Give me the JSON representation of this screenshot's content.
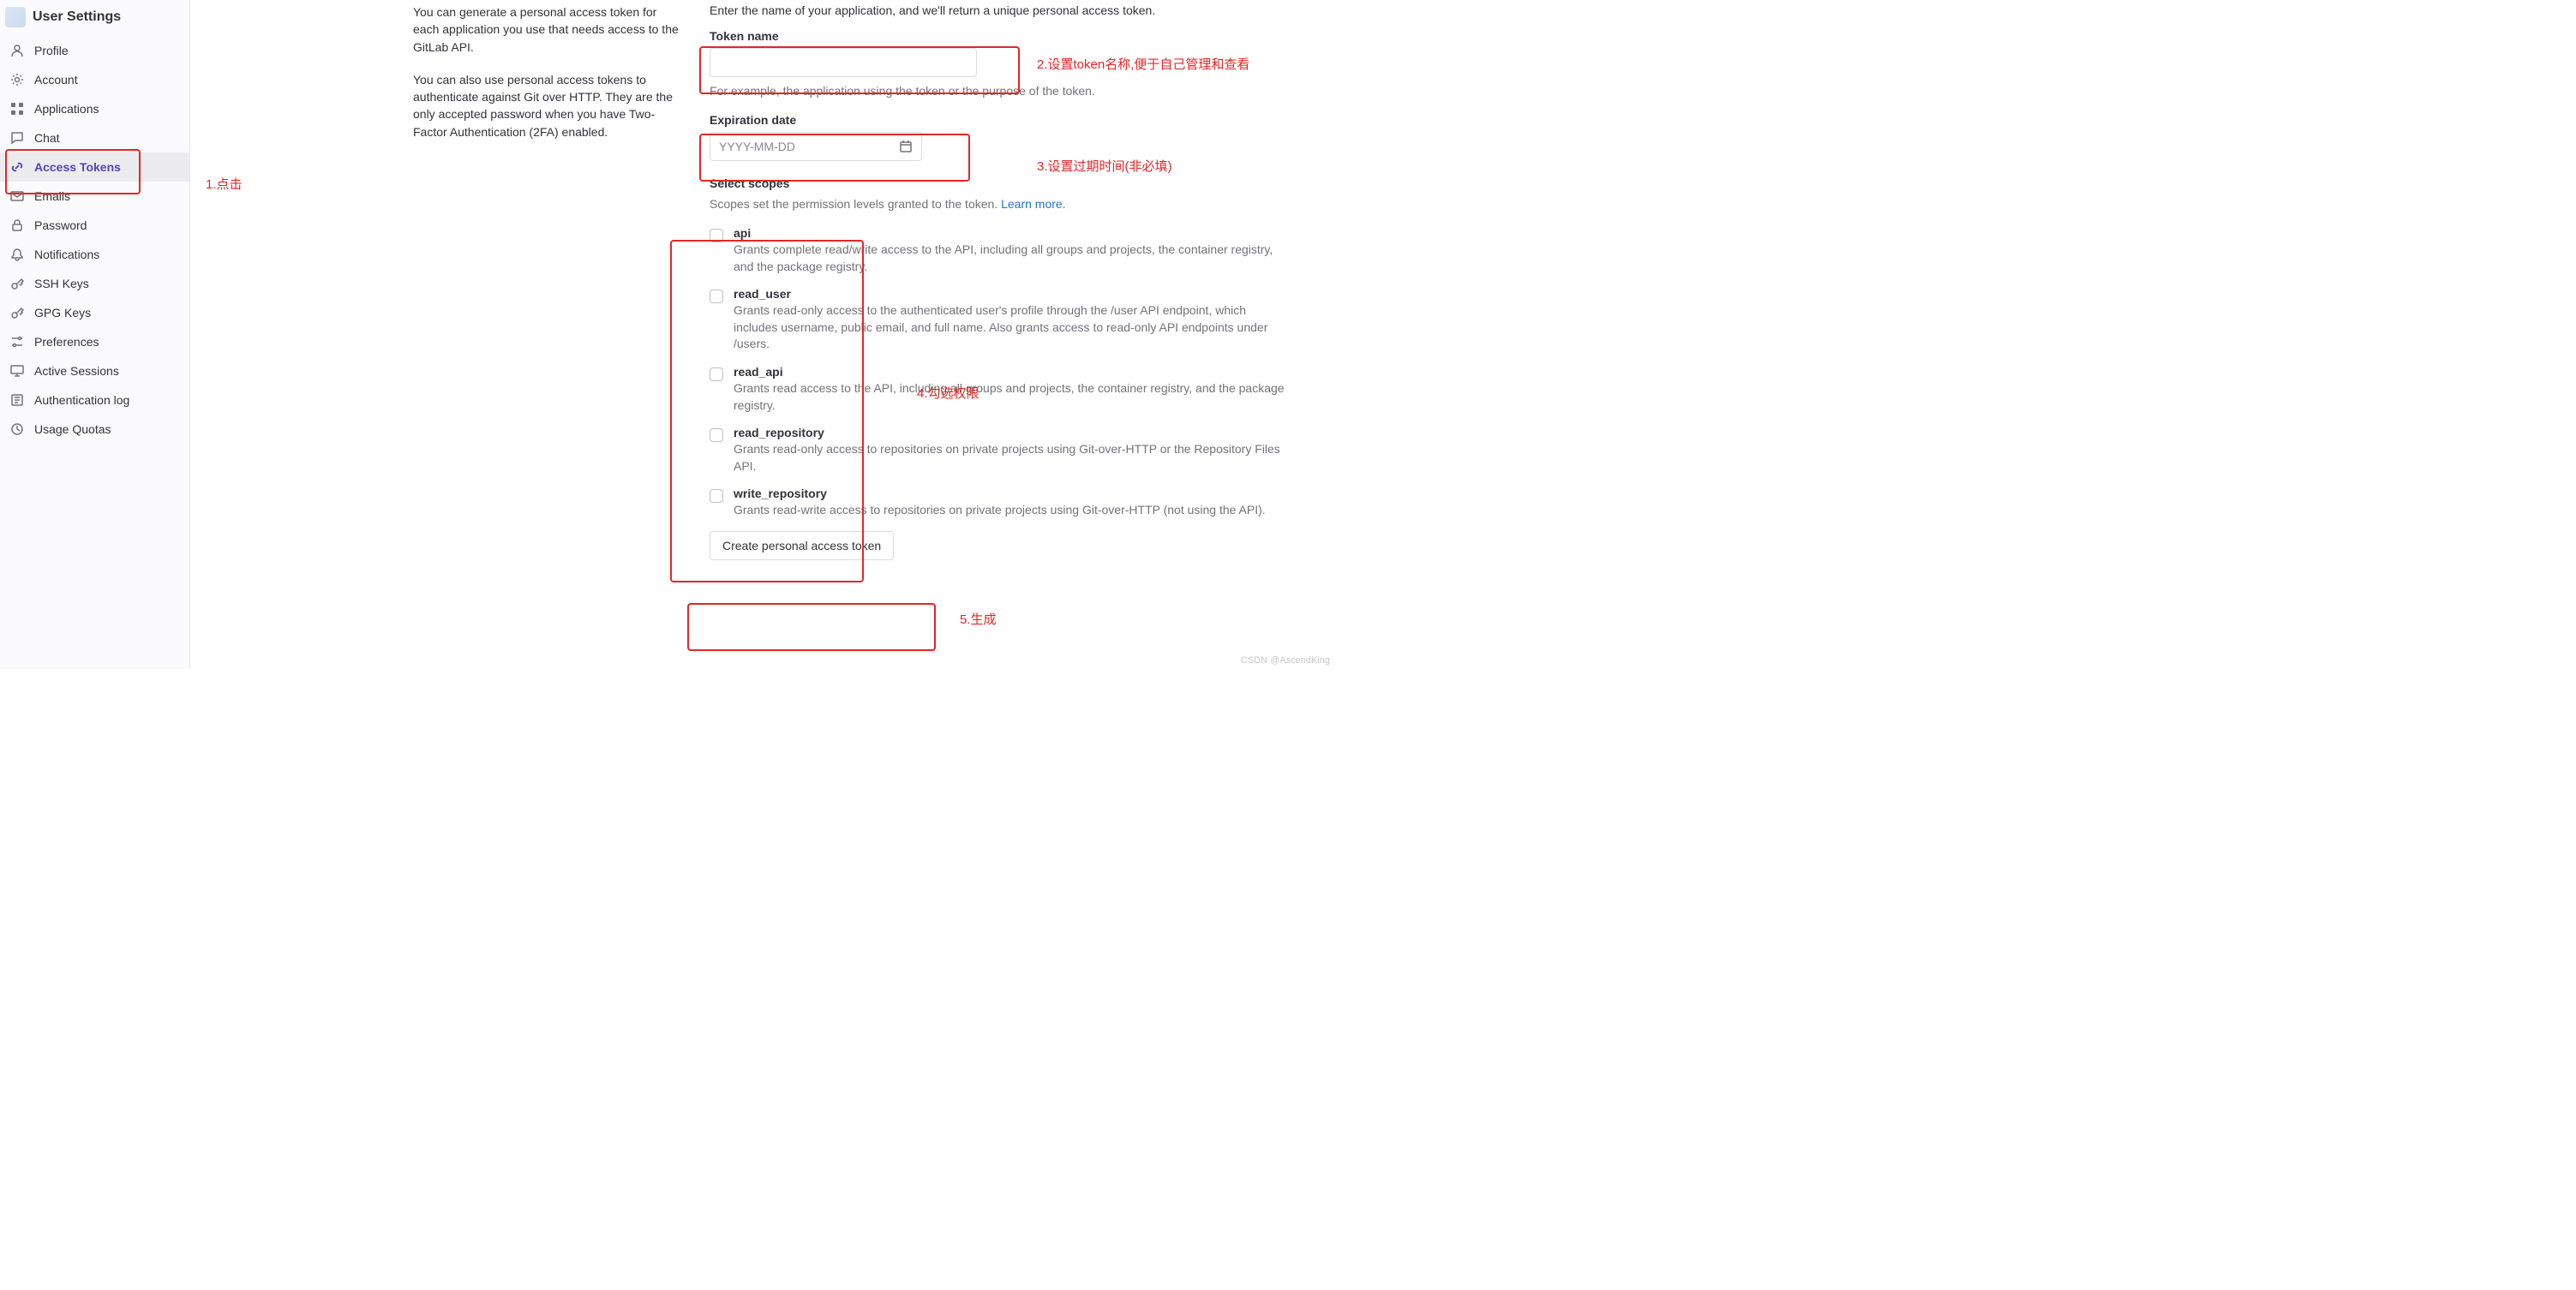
{
  "sidebar": {
    "title": "User Settings",
    "items": [
      {
        "label": "Profile",
        "icon": "profile"
      },
      {
        "label": "Account",
        "icon": "account"
      },
      {
        "label": "Applications",
        "icon": "applications"
      },
      {
        "label": "Chat",
        "icon": "chat"
      },
      {
        "label": "Access Tokens",
        "icon": "token",
        "active": true
      },
      {
        "label": "Emails",
        "icon": "email"
      },
      {
        "label": "Password",
        "icon": "lock"
      },
      {
        "label": "Notifications",
        "icon": "bell"
      },
      {
        "label": "SSH Keys",
        "icon": "key"
      },
      {
        "label": "GPG Keys",
        "icon": "key"
      },
      {
        "label": "Preferences",
        "icon": "preferences"
      },
      {
        "label": "Active Sessions",
        "icon": "monitor"
      },
      {
        "label": "Authentication log",
        "icon": "log"
      },
      {
        "label": "Usage Quotas",
        "icon": "quota"
      }
    ]
  },
  "desc": {
    "p1": "You can generate a personal access token for each application you use that needs access to the GitLab API.",
    "p2": "You can also use personal access tokens to authenticate against Git over HTTP. They are the only accepted password when you have Two-Factor Authentication (2FA) enabled."
  },
  "form": {
    "intro": "Enter the name of your application, and we'll return a unique personal access token.",
    "token_name_label": "Token name",
    "token_name_value": "",
    "token_name_help": "For example, the application using the token or the purpose of the token.",
    "expiration_label": "Expiration date",
    "expiration_placeholder": "YYYY-MM-DD",
    "scopes_title": "Select scopes",
    "scopes_help_text": "Scopes set the permission levels granted to the token. ",
    "scopes_help_link": "Learn more.",
    "scopes": [
      {
        "key": "api",
        "name": "api",
        "desc": "Grants complete read/write access to the API, including all groups and projects, the container registry, and the package registry."
      },
      {
        "key": "read_user",
        "name": "read_user",
        "desc": "Grants read-only access to the authenticated user's profile through the /user API endpoint, which includes username, public email, and full name. Also grants access to read-only API endpoints under /users."
      },
      {
        "key": "read_api",
        "name": "read_api",
        "desc": "Grants read access to the API, including all groups and projects, the container registry, and the package registry."
      },
      {
        "key": "read_repository",
        "name": "read_repository",
        "desc": "Grants read-only access to repositories on private projects using Git-over-HTTP or the Repository Files API."
      },
      {
        "key": "write_repository",
        "name": "write_repository",
        "desc": "Grants read-write access to repositories on private projects using Git-over-HTTP (not using the API)."
      }
    ],
    "submit": "Create personal access token"
  },
  "annotations": {
    "a1": "1.点击",
    "a2": "2.设置token名称,便于自己管理和查看",
    "a3": "3.设置过期时间(非必填)",
    "a4": "4.勾选权限",
    "a5": "5.生成"
  },
  "watermark": "CSDN @AscendKing"
}
